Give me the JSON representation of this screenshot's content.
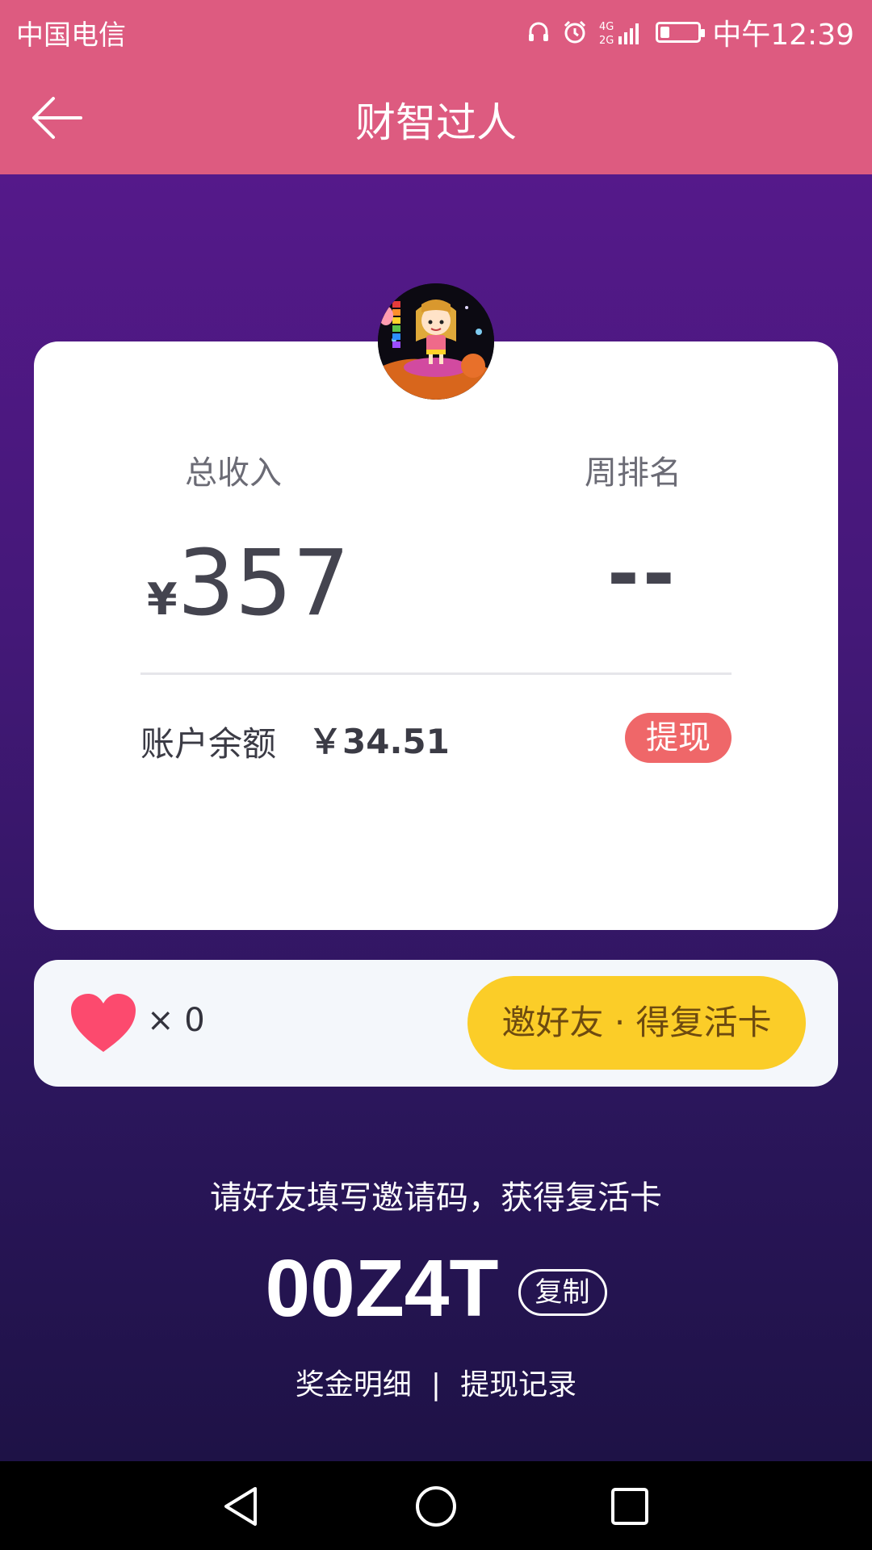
{
  "status_bar": {
    "carrier": "中国电信",
    "network": "4G 2G",
    "battery_level": 0.25,
    "time": "中午12:39"
  },
  "header": {
    "title": "财智过人",
    "back_icon": "arrow-left-icon"
  },
  "card": {
    "avatar": "avatar-cartoon-girl",
    "total_income_label": "总收入",
    "currency_symbol": "¥",
    "total_income_value": "357",
    "weekly_rank_label": "周排名",
    "weekly_rank_value": "--",
    "balance_label": "账户余额",
    "balance_value": "￥34.51",
    "withdraw_label": "提现"
  },
  "lives": {
    "icon": "heart-icon",
    "count_text": "× 0",
    "invite_button_label": "邀好友 · 得复活卡"
  },
  "invite": {
    "hint": "请好友填写邀请码，获得复活卡",
    "code": "00Z4T",
    "copy_label": "复制"
  },
  "links": {
    "bonus_details": "奖金明细",
    "separator": "|",
    "withdraw_records": "提现记录"
  },
  "nav": {
    "back_icon": "triangle-back-icon",
    "home_icon": "circle-home-icon",
    "recents_icon": "square-recents-icon"
  },
  "colors": {
    "header": "#dd5b80",
    "gradient_top": "#55198a",
    "gradient_bottom": "#1e1246",
    "withdraw": "#ef6769",
    "invite_button": "#fbcd28",
    "heart": "#fc4a6e"
  }
}
